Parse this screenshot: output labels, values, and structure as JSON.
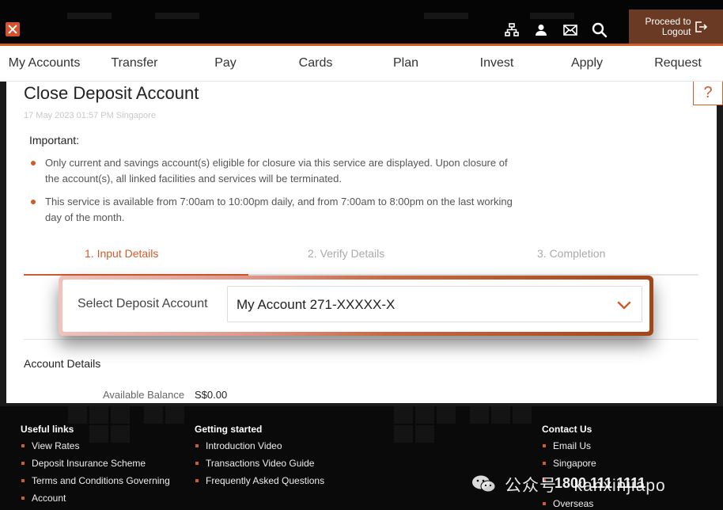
{
  "header": {
    "logout_label_line1": "Proceed to",
    "logout_label_line2": "Logout",
    "icons": [
      "sitemap-icon",
      "user-icon",
      "mail-icon",
      "search-icon",
      "logout-icon"
    ]
  },
  "nav": {
    "items": [
      "My Accounts",
      "Transfer",
      "Pay",
      "Cards",
      "Plan",
      "Invest",
      "Apply",
      "Request"
    ]
  },
  "page": {
    "help_label": "?",
    "title": "Close Deposit Account",
    "timestamp": "17 May 2023 01:57 PM Singapore",
    "important_heading": "Important:",
    "notes": [
      "Only current and savings account(s) eligible for closure via this service are displayed. Upon closure of the account(s), all linked facilities and services will be terminated.",
      "This service is available from 7:00am to 10:00pm daily, and from 7:00am to 8:00pm on the last working day of the month."
    ]
  },
  "steps": {
    "items": [
      "1. Input Details",
      "2. Verify Details",
      "3. Completion"
    ],
    "active_index": 0
  },
  "form": {
    "select_label": "Select Deposit Account",
    "select_value": "My Account 271-XXXXX-X"
  },
  "account_details": {
    "heading": "Account Details",
    "balance_label": "Available Balance",
    "balance_value": "S$0.00"
  },
  "footer": {
    "useful_links": {
      "heading": "Useful links",
      "items": [
        "View Rates",
        "Deposit Insurance Scheme",
        "Terms and Conditions Governing",
        "Account"
      ]
    },
    "getting_started": {
      "heading": "Getting started",
      "items": [
        "Introduction Video",
        "Transactions Video Guide",
        "Frequently Asked Questions"
      ]
    },
    "contact_us": {
      "heading": "Contact Us",
      "items": [
        "Email Us",
        "Singapore",
        "1800 111 1111",
        "Overseas"
      ]
    },
    "watermark": "公众号 · kanxinjiapo"
  },
  "colors": {
    "accent": "#d05c2b",
    "header_bg": "#050505",
    "logout_bg": "#6a3a24",
    "footer_bg": "#0a0a0a"
  }
}
